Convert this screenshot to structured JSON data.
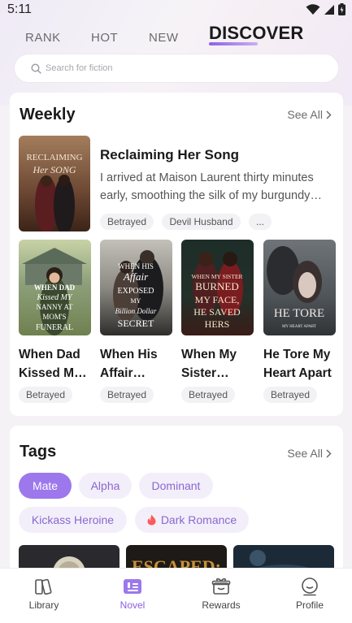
{
  "status_bar": {
    "time": "5:11"
  },
  "top_tabs": [
    "RANK",
    "HOT",
    "NEW"
  ],
  "active_tab": "DISCOVER",
  "search": {
    "placeholder": "Search for fiction"
  },
  "weekly": {
    "title": "Weekly",
    "see_all": "See All",
    "featured": {
      "cover_text": [
        "RECLAIMING",
        "Her SONG"
      ],
      "title": "Reclaiming Her Song",
      "description": "I arrived at Maison Laurent thirty minutes early, smoothing the silk of my burgundy dress...",
      "tags": [
        "Betrayed",
        "Devil Husband",
        "..."
      ]
    },
    "books": [
      {
        "cover_text": [
          "WHEN DAD",
          "Kissed MY",
          "NANNY AT",
          "MOM'S",
          "FUNERAL"
        ],
        "title": "When Dad Kissed My Nanny at Mom's Funeral",
        "tag": "Betrayed"
      },
      {
        "cover_text": [
          "WHEN HIS",
          "Affair",
          "EXPOSED",
          "MY",
          "Billion Dollar",
          "SECRET"
        ],
        "title": "When His Affair Exposed My Billion Dollar Secret",
        "tag": "Betrayed"
      },
      {
        "cover_text": [
          "WHEN MY SISTER",
          "BURNED",
          "MY FACE,",
          "HE SAVED",
          "HERS"
        ],
        "title": "When My Sister Burned My Face, He Saved Hers",
        "tag": "Betrayed"
      },
      {
        "cover_text": [
          "HE TORE",
          "MY HEART APART"
        ],
        "title": "He Tore My Heart Apart",
        "tag": "Betrayed"
      }
    ]
  },
  "tags_section": {
    "title": "Tags",
    "see_all": "See All",
    "tags": [
      "Mate",
      "Alpha",
      "Dominant",
      "Kickass Heroine",
      "Dark Romance"
    ],
    "active_tag": "Mate",
    "thumb_text": "ESCAPED:"
  },
  "bottom_nav": [
    {
      "label": "Library",
      "icon": "library-icon"
    },
    {
      "label": "Novel",
      "icon": "novel-icon"
    },
    {
      "label": "Rewards",
      "icon": "rewards-icon"
    },
    {
      "label": "Profile",
      "icon": "profile-icon"
    }
  ],
  "active_nav": "Novel",
  "colors": {
    "accent": "#9c78ec",
    "accent_text": "#8a5fe0",
    "chip_bg": "#f2f1f4",
    "tag_bg": "#f3effa"
  }
}
